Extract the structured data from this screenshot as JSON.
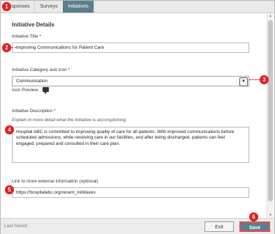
{
  "tabs": [
    {
      "label": "Responses"
    },
    {
      "label": "Surveys"
    },
    {
      "label": "Initiatives"
    }
  ],
  "section": {
    "title": "Initiative Details"
  },
  "fields": {
    "title": {
      "label": "Initiative Title *",
      "value": "Improving Communications for Patient Care"
    },
    "category": {
      "label": "Initiative Category and Icon *",
      "value": "Communication",
      "icon_preview_label": "Icon Preview:",
      "icon": "chat-bubble-icon"
    },
    "description": {
      "label": "Initiative Description *",
      "hint": "Explain in more detail what the initiative is accomplishing",
      "value": "Hospital ABC is committed to improving quality of care for all patients. With improved communications before scheduled admissions, while receiving care in our facilities, and after being discharged, patients can feel engaged, prepared and consulted in their care plan."
    },
    "link": {
      "label": "Link to more external information (optional)",
      "value": "https://hospitalabc.org/recent_initiitaves"
    }
  },
  "footer": {
    "last_saved": "Last Saved:",
    "exit_label": "Exit",
    "save_label": "Save"
  },
  "callouts": [
    "1",
    "2",
    "3",
    "4",
    "5",
    "6"
  ],
  "colors": {
    "accent": "#5a7f8f",
    "callout": "#e02020"
  }
}
